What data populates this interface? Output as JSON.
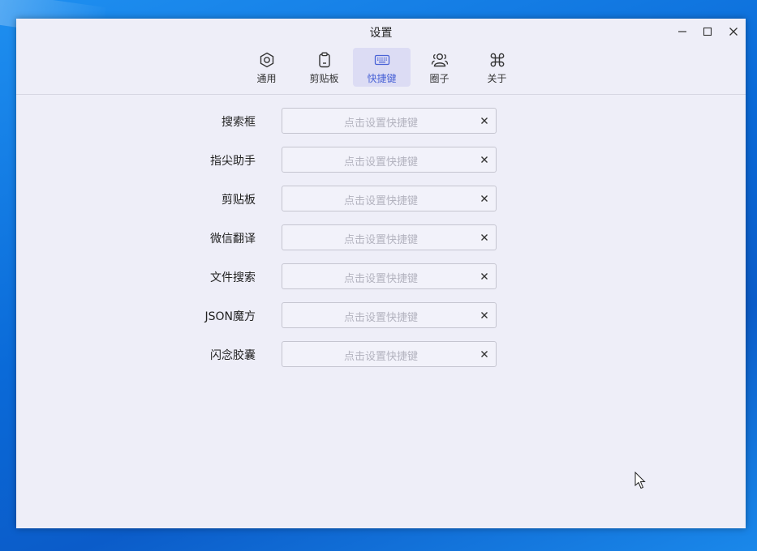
{
  "window": {
    "title": "设置"
  },
  "controls": {
    "minimize": "minimize-icon",
    "maximize": "maximize-icon",
    "close": "close-icon"
  },
  "tabs": [
    {
      "label": "通用",
      "icon": "settings-hex-icon",
      "active": false
    },
    {
      "label": "剪贴板",
      "icon": "clipboard-icon",
      "active": false
    },
    {
      "label": "快捷键",
      "icon": "keyboard-icon",
      "active": true
    },
    {
      "label": "圈子",
      "icon": "group-icon",
      "active": false
    },
    {
      "label": "关于",
      "icon": "command-icon",
      "active": false
    }
  ],
  "shortcuts": [
    {
      "label": "搜索框",
      "placeholder": "点击设置快捷键"
    },
    {
      "label": "指尖助手",
      "placeholder": "点击设置快捷键"
    },
    {
      "label": "剪贴板",
      "placeholder": "点击设置快捷键"
    },
    {
      "label": "微信翻译",
      "placeholder": "点击设置快捷键"
    },
    {
      "label": "文件搜索",
      "placeholder": "点击设置快捷键"
    },
    {
      "label": "JSON魔方",
      "placeholder": "点击设置快捷键"
    },
    {
      "label": "闪念胶囊",
      "placeholder": "点击设置快捷键"
    }
  ],
  "colors": {
    "accent": "#4a63d6",
    "window_bg": "#eeeef8",
    "active_tab_bg": "#dcdcf4"
  }
}
